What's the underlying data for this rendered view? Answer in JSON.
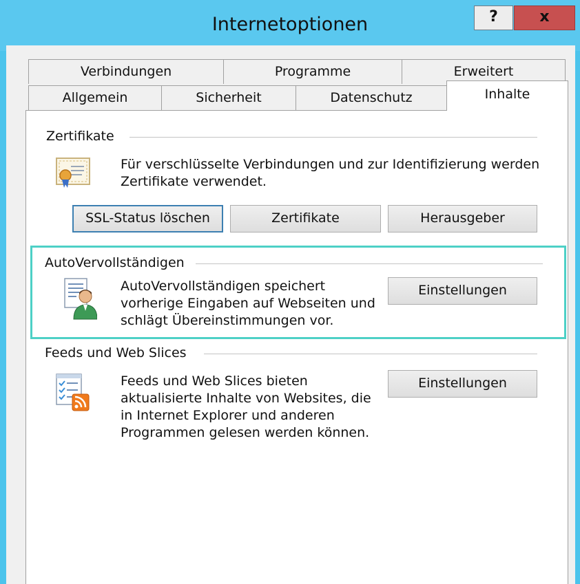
{
  "window": {
    "title": "Internetoptionen",
    "help_label": "?",
    "close_label": "x"
  },
  "tabs": {
    "row1": [
      "Verbindungen",
      "Programme",
      "Erweitert"
    ],
    "row2": [
      "Allgemein",
      "Sicherheit",
      "Datenschutz",
      "Inhalte"
    ],
    "active": "Inhalte"
  },
  "certificates": {
    "group_title": "Zertifikate",
    "description_line1": "Für verschlüsselte Verbindungen und zur Identifizierung werden",
    "description_line2": "Zertifikate verwendet.",
    "ssl_button": "SSL-Status löschen",
    "certificates_button": "Zertifikate",
    "publishers_button": "Herausgeber",
    "icon": "certificate-icon"
  },
  "autocomplete": {
    "group_title": "AutoVervollständigen",
    "description_line1": "AutoVervollständigen speichert",
    "description_line2": "vorherige Eingaben auf Webseiten und",
    "description_line3": "schlägt Übereinstimmungen vor.",
    "settings_button": "Einstellungen",
    "icon": "autocomplete-user-icon"
  },
  "feeds": {
    "group_title": "Feeds und Web Slices",
    "description_line1": "Feeds und Web Slices bieten",
    "description_line2": "aktualisierte Inhalte von Websites, die",
    "description_line3": "in Internet Explorer und anderen",
    "description_line4": "Programmen gelesen werden können.",
    "settings_button": "Einstellungen",
    "icon": "rss-feed-icon"
  },
  "colors": {
    "titlebar": "#5ac8ef",
    "close_button": "#c75050",
    "focus_highlight": "#4dd0c6",
    "default_button_border": "#3c7fb1"
  }
}
